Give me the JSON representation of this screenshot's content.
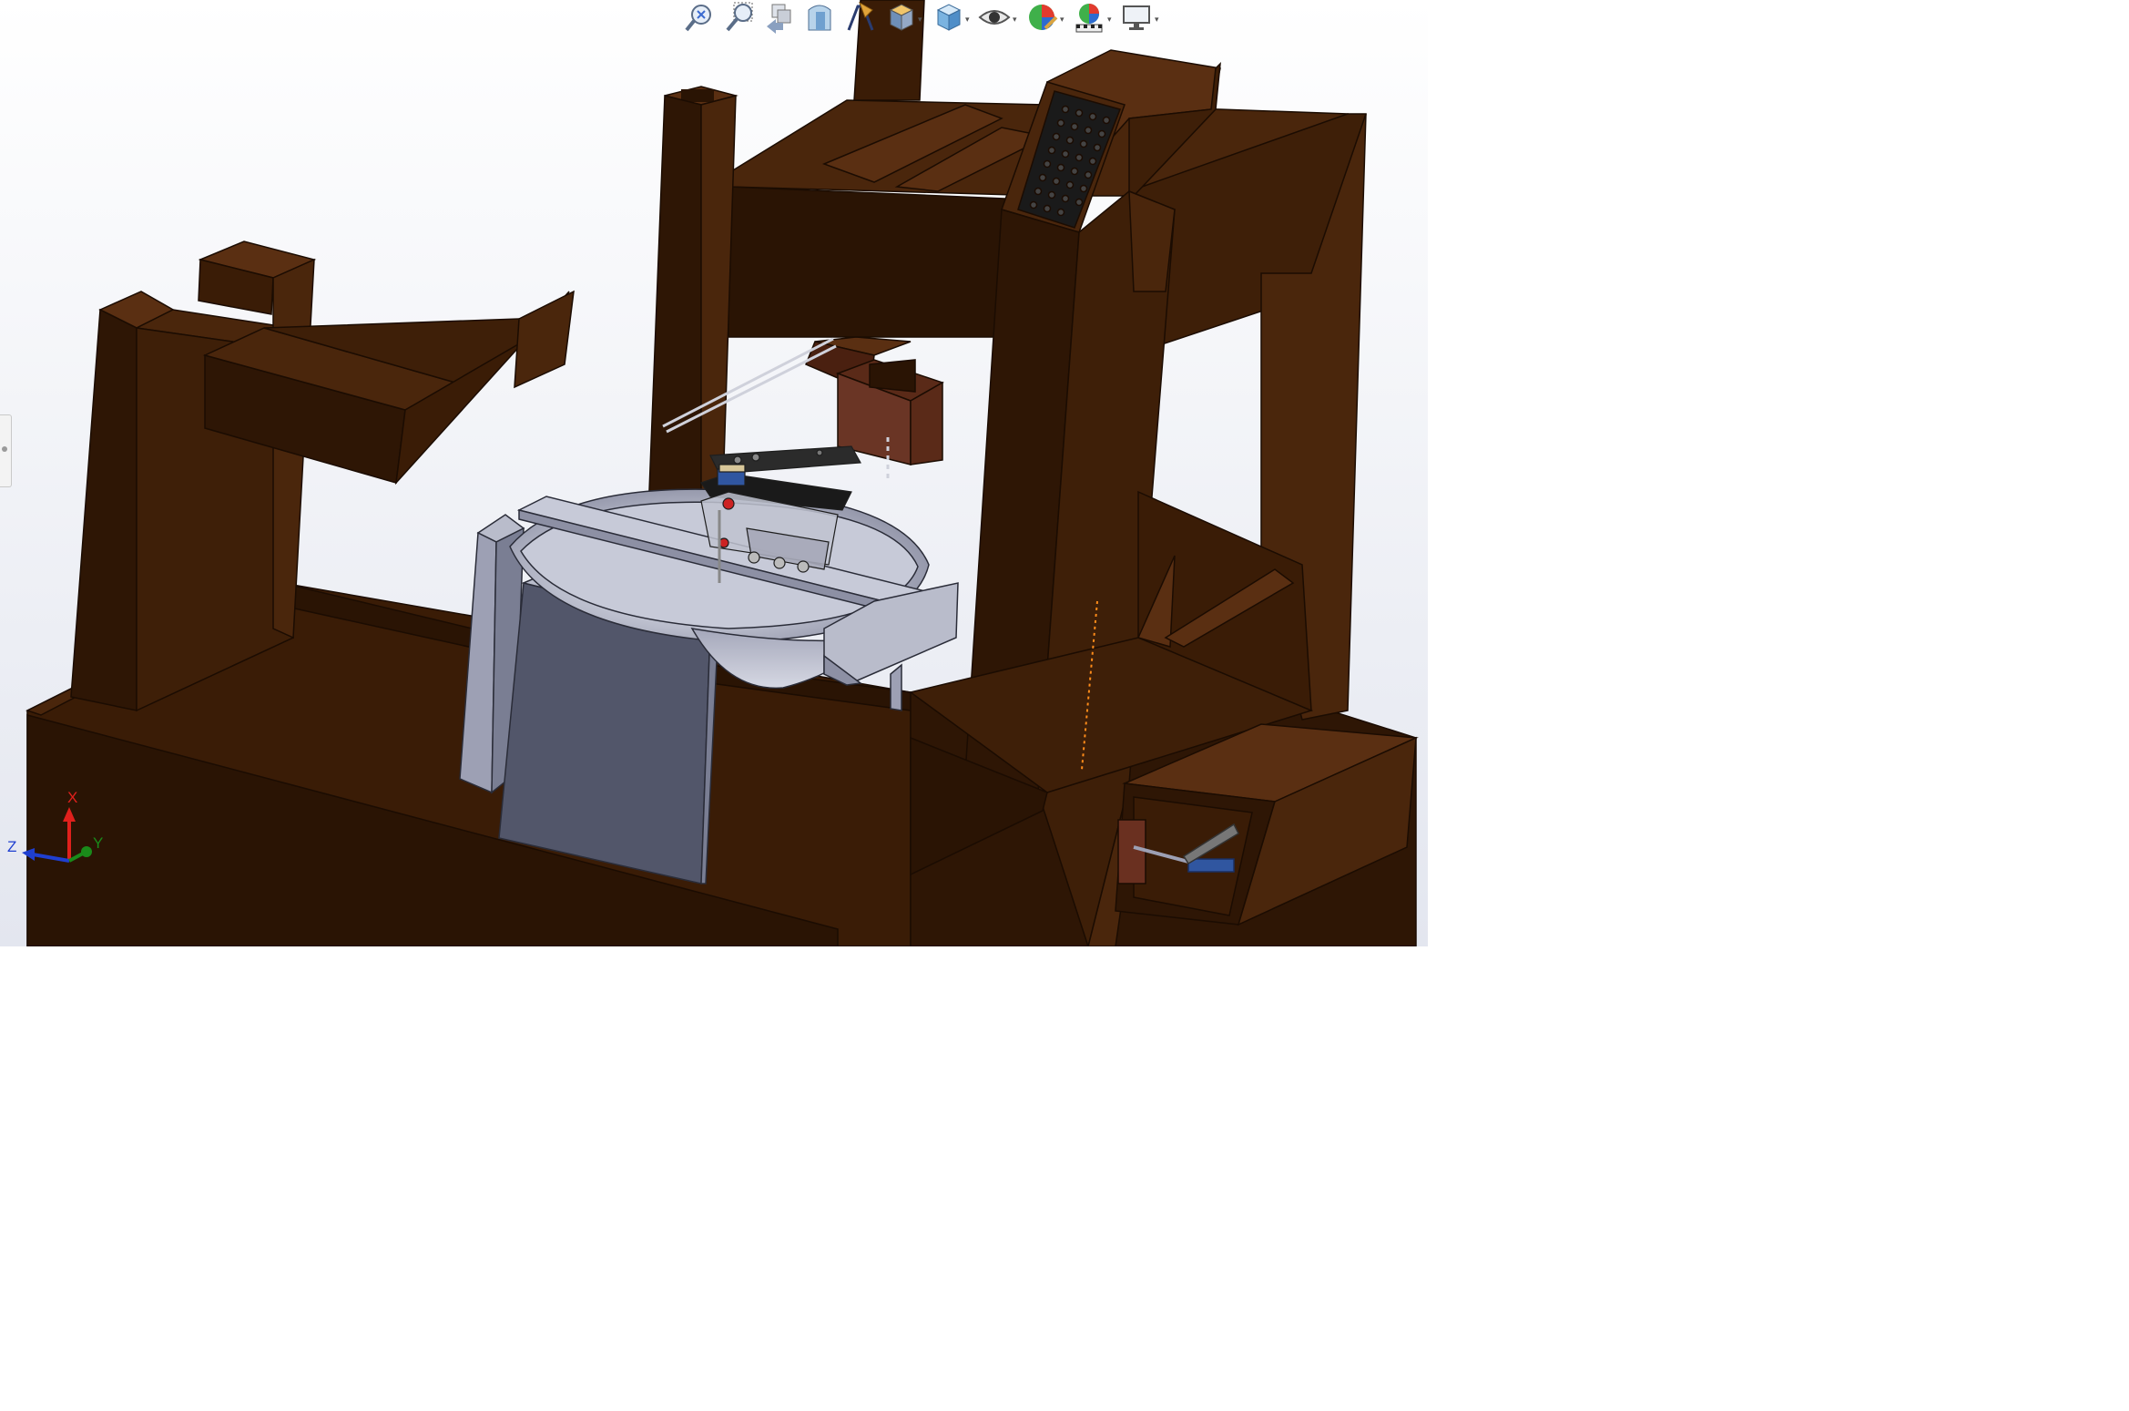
{
  "view": {
    "background_top": "#ffffff",
    "background_bottom": "#e3e6ef",
    "model_colors": {
      "wood_light": "#5a2f12",
      "wood_mid": "#3e1f08",
      "wood_dark": "#2a1404",
      "wood_edge": "#1b0c02",
      "metal_light": "#d4d6e2",
      "metal_mid": "#9da0b4",
      "metal_dark": "#52566a",
      "panel_dark": "#2b2b2b"
    }
  },
  "heads_up_toolbar": {
    "tools": [
      {
        "name": "zoom-to-fit",
        "icon": "zoom-fit-icon"
      },
      {
        "name": "zoom-to-area",
        "icon": "zoom-area-icon"
      },
      {
        "name": "previous-view",
        "icon": "previous-view-icon"
      },
      {
        "name": "section-view",
        "icon": "section-view-icon"
      },
      {
        "name": "dynamic-annotation-views",
        "icon": "annotation-view-icon"
      },
      {
        "name": "view-orientation",
        "icon": "view-orientation-icon",
        "dropdown": true
      },
      {
        "name": "display-style",
        "icon": "display-style-icon",
        "dropdown": true
      },
      {
        "name": "hide-show-items",
        "icon": "hide-show-icon",
        "dropdown": true
      },
      {
        "name": "edit-appearance",
        "icon": "edit-appearance-icon",
        "dropdown": true
      },
      {
        "name": "apply-scene",
        "icon": "apply-scene-icon",
        "dropdown": true
      },
      {
        "name": "view-settings",
        "icon": "view-settings-icon",
        "dropdown": true
      }
    ],
    "dropdown_glyph": "▾"
  },
  "triad": {
    "x_label": "X",
    "y_label": "Y",
    "z_label": "Z",
    "x_color": "#e0201c",
    "y_color": "#1a8a1a",
    "z_color": "#1f3fd0"
  }
}
